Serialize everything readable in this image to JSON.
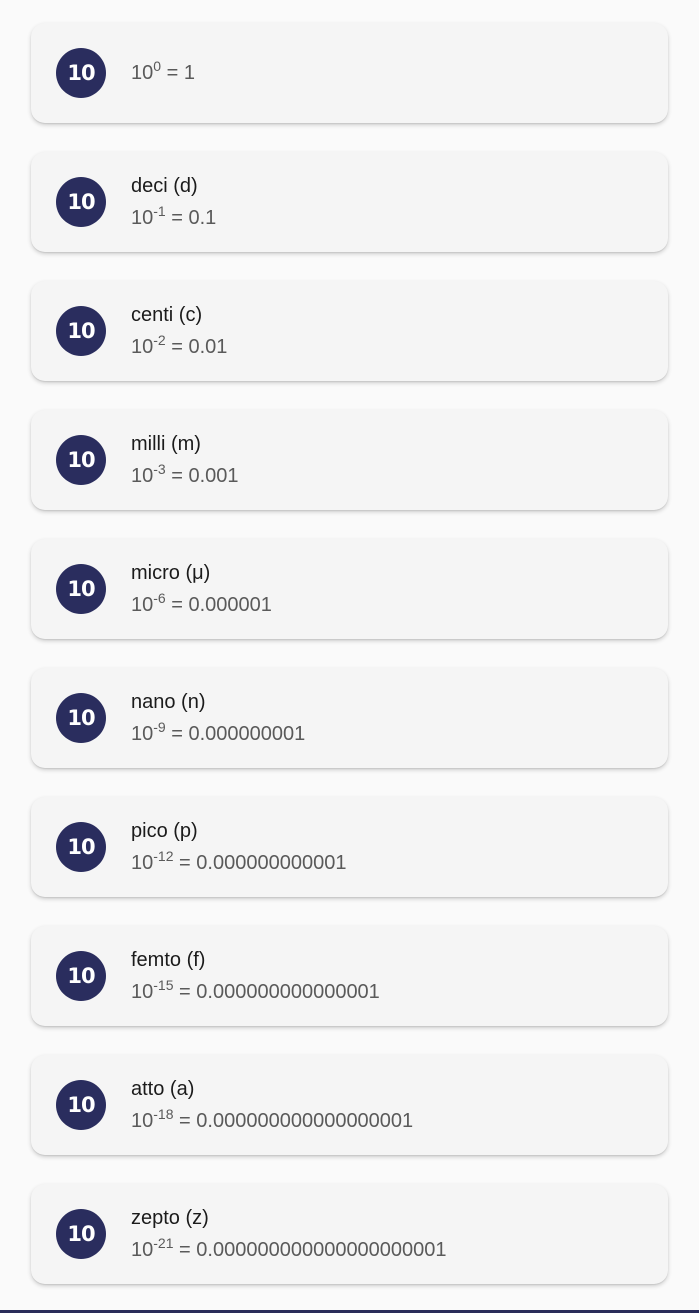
{
  "items": [
    {
      "name": "",
      "base": "10",
      "exp": "0",
      "value": "1"
    },
    {
      "name": "deci (d)",
      "base": "10",
      "exp": "-1",
      "value": "0.1"
    },
    {
      "name": "centi (c)",
      "base": "10",
      "exp": "-2",
      "value": "0.01"
    },
    {
      "name": "milli (m)",
      "base": "10",
      "exp": "-3",
      "value": "0.001"
    },
    {
      "name": "micro (μ)",
      "base": "10",
      "exp": "-6",
      "value": "0.000001"
    },
    {
      "name": "nano (n)",
      "base": "10",
      "exp": "-9",
      "value": "0.000000001"
    },
    {
      "name": "pico (p)",
      "base": "10",
      "exp": "-12",
      "value": "0.000000000001"
    },
    {
      "name": "femto (f)",
      "base": "10",
      "exp": "-15",
      "value": "0.000000000000001"
    },
    {
      "name": "atto (a)",
      "base": "10",
      "exp": "-18",
      "value": "0.000000000000000001"
    },
    {
      "name": "zepto (z)",
      "base": "10",
      "exp": "-21",
      "value": "0.000000000000000000001"
    }
  ],
  "badge_label": "10",
  "colors": {
    "badge": "#2a2d5e",
    "card": "#f5f5f5",
    "background": "#fafafa"
  }
}
